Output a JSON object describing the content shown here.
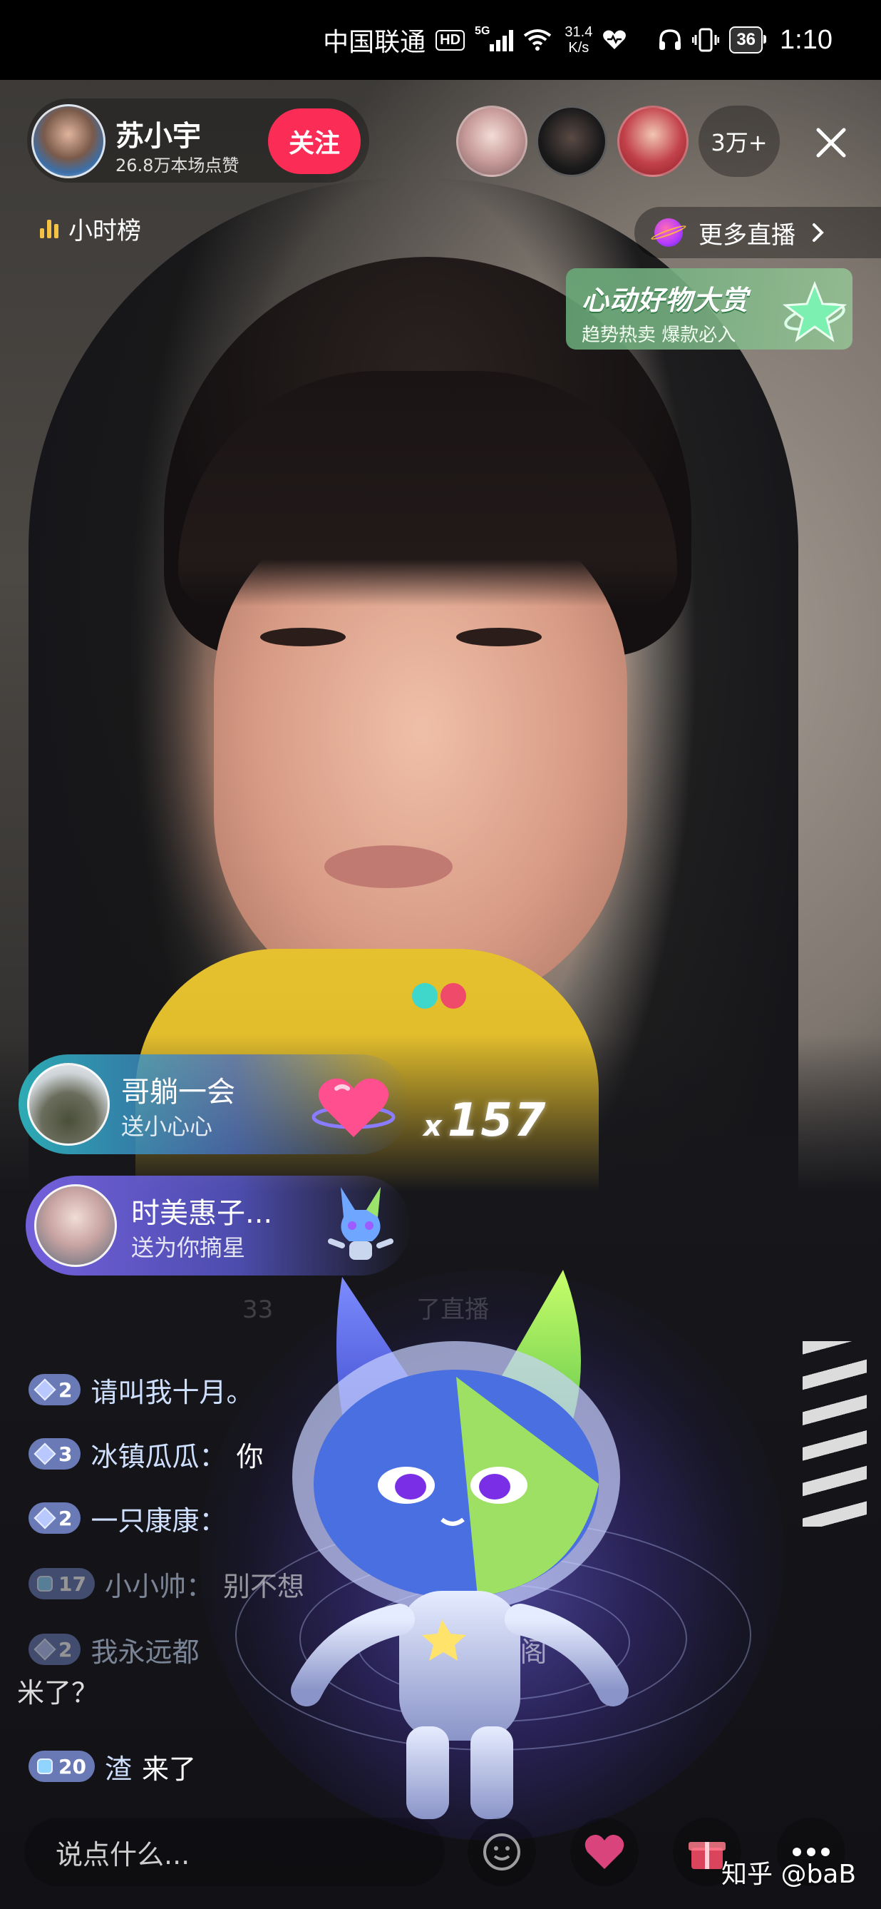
{
  "status_bar": {
    "carrier": "中国联通",
    "hd_badge": "HD",
    "network": "5G",
    "speed_value": "31.4",
    "speed_unit": "K/s",
    "battery": "36",
    "time": "1:10",
    "icons": [
      "signal-bars-icon",
      "wifi-icon",
      "heart-health-icon",
      "headphones-icon",
      "vibrate-icon",
      "battery-icon"
    ]
  },
  "host": {
    "name": "苏小宇",
    "likes": "26.8万本场点赞",
    "follow_label": "关注"
  },
  "viewers": {
    "count_label": "3万+"
  },
  "hour_rank": {
    "label": "小时榜"
  },
  "more_live": {
    "label": "更多直播"
  },
  "promo": {
    "title": "心动好物大赏",
    "subtitle": "趋势热卖 爆款必入"
  },
  "gifts": [
    {
      "user": "哥躺一会",
      "action": "送小心心",
      "combo_prefix": "x",
      "combo_count": "157"
    },
    {
      "user": "时美惠子...",
      "action": "送为你摘星"
    }
  ],
  "chat": {
    "faded_line": "33",
    "faded_text": "了直播",
    "messages": [
      {
        "level": "2",
        "user": "请叫我十月。",
        "text": ""
      },
      {
        "level": "3",
        "user": "冰镇瓜瓜：",
        "text": "你"
      },
      {
        "level": "2",
        "user": "一只康康：",
        "text": ""
      },
      {
        "level": "17",
        "user": "小小帅：",
        "text": "别不想"
      },
      {
        "level": "2",
        "user": "我永远都",
        "text": "礼物阁"
      },
      {
        "level": "20",
        "user": "渣",
        "text": "来了"
      }
    ],
    "continuation": "米了？"
  },
  "bottom_bar": {
    "input_placeholder": "说点什么...",
    "watermark": "知乎 @baB"
  },
  "colors": {
    "follow_button": "#fb2c55",
    "promo_green": "#68aa78",
    "gift1_start": "#2ebac4",
    "gift2_start": "#7864e6",
    "dot_teal": "#3fd6cc",
    "dot_pink": "#f04a6a"
  }
}
